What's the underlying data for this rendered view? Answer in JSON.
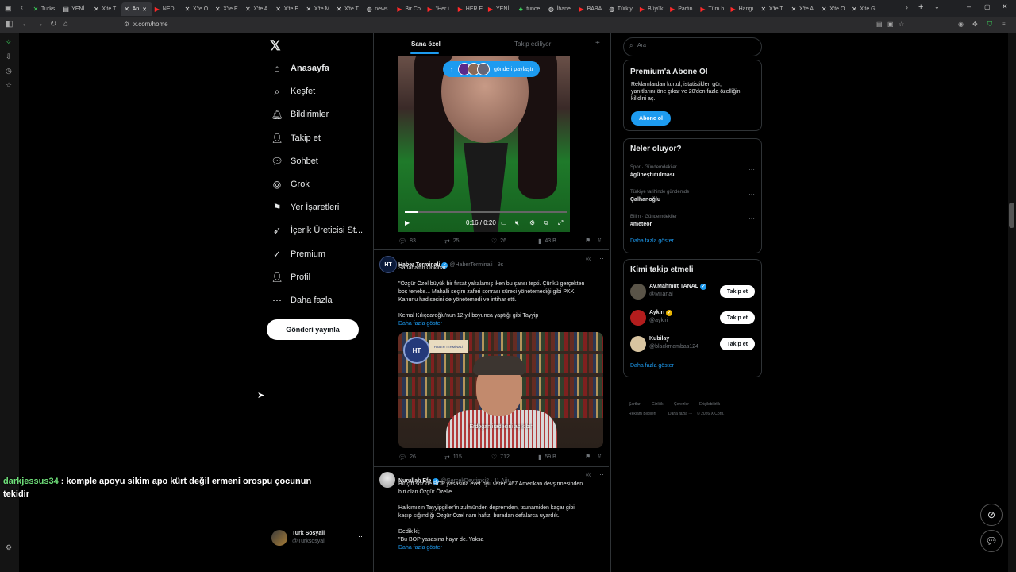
{
  "browser": {
    "tabs": [
      {
        "label": "Turks",
        "icon": "x-icon",
        "color": "#3dd35c"
      },
      {
        "label": "YENİ",
        "icon": "doc-icon"
      },
      {
        "label": "X'te T",
        "icon": "x-icon"
      },
      {
        "label": "An",
        "icon": "x-icon",
        "active": true
      },
      {
        "label": "NEDI",
        "icon": "youtube-icon"
      },
      {
        "label": "X'te O",
        "icon": "x-icon"
      },
      {
        "label": "X'te E",
        "icon": "x-icon"
      },
      {
        "label": "X'te A",
        "icon": "x-icon"
      },
      {
        "label": "X'te E",
        "icon": "x-icon"
      },
      {
        "label": "X'te M",
        "icon": "x-icon"
      },
      {
        "label": "X'te T",
        "icon": "x-icon"
      },
      {
        "label": "news",
        "icon": "globe-icon"
      },
      {
        "label": "Bir Co",
        "icon": "youtube-icon"
      },
      {
        "label": "\"Her i",
        "icon": "youtube-icon"
      },
      {
        "label": "HER E",
        "icon": "youtube-icon"
      },
      {
        "label": "YENİ",
        "icon": "youtube-icon"
      },
      {
        "label": "tunce",
        "icon": "leaf-icon"
      },
      {
        "label": "İhane",
        "icon": "globe-icon"
      },
      {
        "label": "BABA",
        "icon": "youtube-icon"
      },
      {
        "label": "Türkiy",
        "icon": "globe-icon"
      },
      {
        "label": "Büyük",
        "icon": "youtube-icon"
      },
      {
        "label": "Partin",
        "icon": "youtube-icon"
      },
      {
        "label": "Tüm h",
        "icon": "youtube-icon"
      },
      {
        "label": "Hangı",
        "icon": "youtube-icon"
      },
      {
        "label": "X'te T",
        "icon": "x-icon"
      },
      {
        "label": "X'te A",
        "icon": "x-icon"
      },
      {
        "label": "X'te O",
        "icon": "x-icon"
      },
      {
        "label": "X'te G",
        "icon": "x-icon"
      }
    ],
    "url": "x.com/home"
  },
  "sidebar": {
    "items": [
      {
        "label": "Anasayfa",
        "icon": "home-icon",
        "glyph": "⌂",
        "bold": true
      },
      {
        "label": "Keşfet",
        "icon": "search-icon",
        "glyph": "⌕"
      },
      {
        "label": "Bildirimler",
        "icon": "bell-icon",
        "glyph": "🔔︎"
      },
      {
        "label": "Takip et",
        "icon": "follow-icon",
        "glyph": "👤︎"
      },
      {
        "label": "Sohbet",
        "icon": "chat-icon",
        "glyph": "💬︎"
      },
      {
        "label": "Grok",
        "icon": "grok-icon",
        "glyph": "◎"
      },
      {
        "label": "Yer İşaretleri",
        "icon": "bookmark-icon",
        "glyph": "⚑"
      },
      {
        "label": "İçerik Üreticisi St...",
        "icon": "rocket-icon",
        "glyph": "➶"
      },
      {
        "label": "Premium",
        "icon": "premium-icon",
        "glyph": "✓"
      },
      {
        "label": "Profil",
        "icon": "profile-icon",
        "glyph": "👤︎"
      },
      {
        "label": "Daha fazla",
        "icon": "more-icon",
        "glyph": "⋯"
      }
    ],
    "post_button": "Gönderi yayınla",
    "account": {
      "name": "Turk Sosyall",
      "handle": "@Turksosyall"
    }
  },
  "timeline": {
    "tabs": [
      "Sana özel",
      "Takip ediliyor"
    ],
    "share_pill": "gönderi paylaştı",
    "video": {
      "time": "0:16 / 0:20",
      "progress": 0.08
    },
    "tweet1_actions": {
      "replies": "83",
      "retweets": "25",
      "likes": "26",
      "views": "43 B"
    },
    "tweet2": {
      "name": "Haber Terminali",
      "handle": "@HaberTerminali · 9s",
      "lines": [
        "Sabahattin Önkibar:",
        "",
        "\"Özgür Özel büyük bir fırsat yakalamış iken bu şansı tepti. Çünkü gerçekten",
        "boş teneke... Mahalli seçim zaferi sonrası süreci yönetemediği gibi PKK",
        "Kanunu hadisesini de yönetemedi ve intihar etti.",
        "",
        "Kemal Kılıçdaroğlu'nun 12 yıl boyunca yaptığı gibi Tayyip"
      ],
      "show_more": "Daha fazla göster",
      "image_logo": "HT",
      "image_banner": "HABER TERMİNALİ",
      "image_subtitle": "Erdoğan iradesini açık bir",
      "actions": {
        "replies": "26",
        "retweets": "115",
        "likes": "712",
        "views": "59 B"
      }
    },
    "tweet3": {
      "name": "Nurullah Efe",
      "handle": "@GercekDevrimci2 · 11 Ağu",
      "lines": [
        "Bir çift söz de BOP yasasına evet oyu veren 467 Amerikan devşirmesinden",
        "biri olan Özgür Özel'e...",
        "",
        "Halkımızın Tayyipgiller'in zulmünden depremden, tsunamiden kaçar gibi",
        "kaçıp sığındığı Özgür Özel nam hafızı buradan defalarca uyardık.",
        "",
        "Dedik ki;",
        "\"Bu BOP yasasına hayır de. Yoksa"
      ],
      "show_more": "Daha fazla göster"
    }
  },
  "right": {
    "search_placeholder": "Ara",
    "premium": {
      "title": "Premium'a Abone Ol",
      "text_lines": [
        "Reklamlardan kurtul, istatistikleri gör,",
        "yanıtlarını öne çıkar ve 20'den fazla özelliğin",
        "kilidini aç."
      ],
      "button": "Abone ol"
    },
    "trends": {
      "title": "Neler oluyor?",
      "items": [
        {
          "meta": "Spor · Gündemdekiler",
          "name": "#güneştutulması"
        },
        {
          "meta": "Türkiye tarihinde gündemde",
          "name": "Çalhanoğlu"
        },
        {
          "meta": "Bilim · Gündemdekiler",
          "name": "#meteor"
        }
      ],
      "show_more": "Daha fazla göster"
    },
    "who_to_follow": {
      "title": "Kimi takip etmeli",
      "items": [
        {
          "name": "Av.Mahmut TANAL",
          "handle": "@MTanal",
          "button": "Takip et",
          "verified_color": "#1d9bf0",
          "avatar_color": "#5a5448"
        },
        {
          "name": "Aykırı",
          "handle": "@aykiri",
          "button": "Takip et",
          "verified_color": "#e8b400",
          "avatar_color": "#b31d1d"
        },
        {
          "name": "Kubilay",
          "handle": "@blackmambas124",
          "button": "Takip et",
          "verified_color": "",
          "avatar_color": "#d8c4a0"
        }
      ],
      "show_more": "Daha fazla göster"
    },
    "footer": [
      "Şartlar",
      "Gizlilik",
      "Çerezler",
      "Erişilebilirlik",
      "Reklam Bilgileri",
      "Daha fazla ···",
      "© 2026 X Corp."
    ]
  },
  "chat": {
    "user": "darkjessus34",
    "message": " : komple apoyu sikim apo kürt değil ermeni orospu çocunun tekidir"
  }
}
